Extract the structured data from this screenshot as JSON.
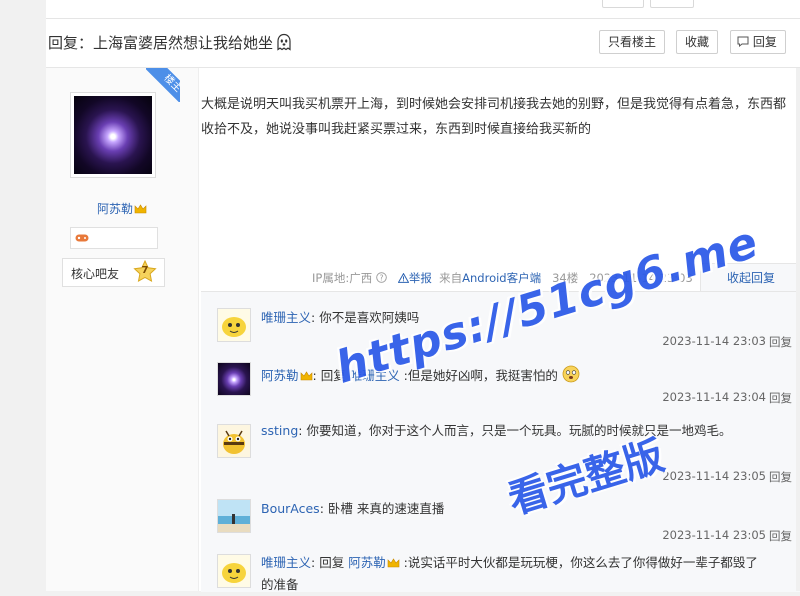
{
  "thread": {
    "title": "回复：上海富婆居然想让我给她坐",
    "buttons": {
      "only_op": "只看楼主",
      "favorite": "收藏",
      "reply": "回复"
    }
  },
  "author": {
    "badge_op": "楼主",
    "name": "阿苏勒",
    "forum_title": "核心吧友",
    "level": "7"
  },
  "post": {
    "content": "大概是说明天叫我买机票开上海，到时候她会安排司机接我去她的别野，但是我觉得有点着急，东西都收拾不及，她说没事叫我赶紧买票过来，东西到时候直接给我买新的",
    "ip": "IP属地:广西",
    "report": "举报",
    "source_prefix": "来自",
    "source_client": "Android客户端",
    "floor": "34楼",
    "time": "2023-11-14 23:03",
    "fold_label": "收起回复"
  },
  "replies": [
    {
      "user": "唯珊主义",
      "sep": ": ",
      "text": "你不是喜欢阿姨吗",
      "time": "2023-11-14 23:03",
      "action": "回复"
    },
    {
      "user": "阿苏勒",
      "sep": ": ",
      "reply_word": "回复 ",
      "reply_to": "唯珊主义",
      "text": " :但是她好凶啊，我挺害怕的",
      "time": "2023-11-14 23:04",
      "action": "回复"
    },
    {
      "user": "ssting",
      "sep": ": ",
      "text": "你要知道，你对于这个人而言，只是一个玩具。玩腻的时候就只是一地鸡毛。",
      "time": "2023-11-14 23:05",
      "action": "回复"
    },
    {
      "user": "BourAces",
      "sep": ": ",
      "text": "卧槽 来真的速速直播",
      "time": "2023-11-14 23:05",
      "action": "回复"
    },
    {
      "user": "唯珊主义",
      "sep": ": ",
      "reply_word": "回复 ",
      "reply_to": "阿苏勒",
      "text": " :说实话平时大伙都是玩玩梗，你这么去了你得做好一辈子都毁了的准备",
      "time": "",
      "action": ""
    }
  ],
  "watermark": {
    "url": "https://51cg6.me",
    "caption": "看完整版"
  },
  "colors": {
    "link": "#2d64b3",
    "ribbon": "#4d8fe8",
    "watermark": "#2b59e8",
    "meta": "#999999",
    "lzl_bg": "#f7f8fa"
  }
}
